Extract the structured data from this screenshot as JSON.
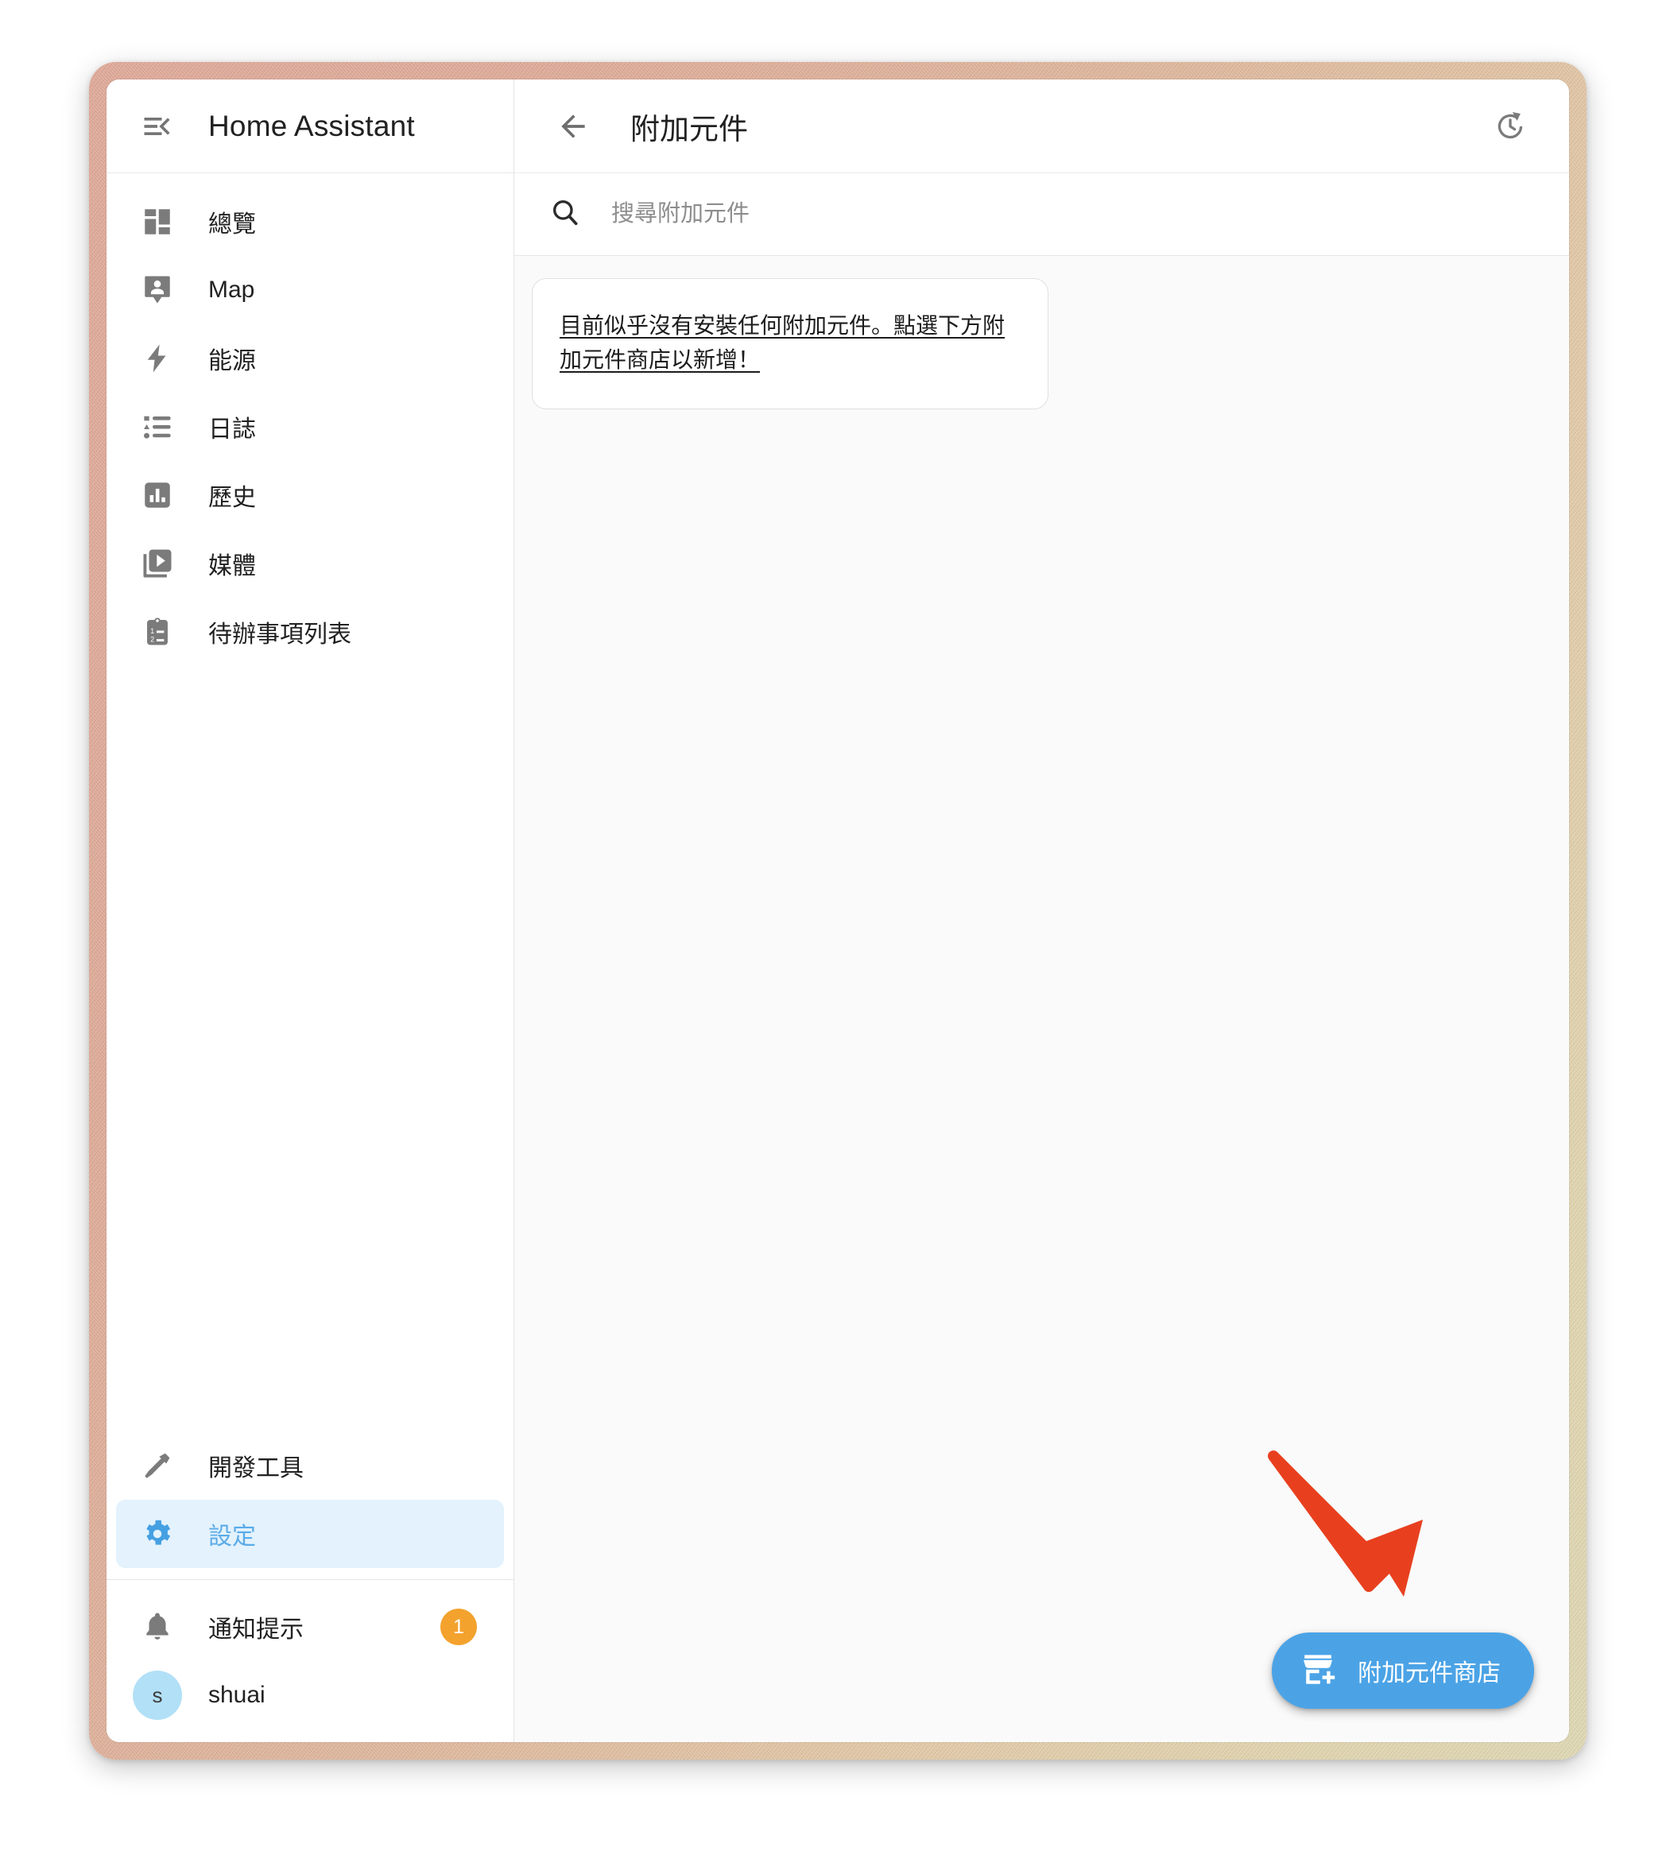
{
  "app": {
    "sidebar_title": "Home Assistant",
    "menu_icon": "menu-collapse-icon"
  },
  "sidebar": {
    "items": [
      {
        "label": "總覽",
        "icon": "view-dashboard-icon",
        "active": false
      },
      {
        "label": "Map",
        "icon": "map-marker-account-icon",
        "active": false
      },
      {
        "label": "能源",
        "icon": "lightning-bolt-icon",
        "active": false
      },
      {
        "label": "日誌",
        "icon": "format-list-bulleted-type-icon",
        "active": false
      },
      {
        "label": "歷史",
        "icon": "chart-box-icon",
        "active": false
      },
      {
        "label": "媒體",
        "icon": "play-box-multiple-icon",
        "active": false
      },
      {
        "label": "待辦事項列表",
        "icon": "clipboard-list-icon",
        "active": false
      }
    ],
    "bottom_items": [
      {
        "label": "開發工具",
        "icon": "hammer-icon",
        "active": false
      },
      {
        "label": "設定",
        "icon": "cog-icon",
        "active": true
      }
    ],
    "notifications": {
      "label": "通知提示",
      "icon": "bell-icon",
      "badge_count": "1",
      "badge_color": "#f3a22d"
    },
    "user": {
      "name": "shuai",
      "avatar_initial": "s",
      "avatar_color": "#b2e0f7"
    },
    "active_color": "#5aabe8",
    "active_background": "#e3f2fd"
  },
  "toolbar": {
    "back_icon": "arrow-left-icon",
    "title": "附加元件",
    "refresh_icon": "update-clock-icon"
  },
  "search": {
    "icon": "search-icon",
    "placeholder": "搜尋附加元件",
    "value": ""
  },
  "content": {
    "empty_message": "目前似乎沒有安裝任何附加元件。點選下方附加元件商店以新增！"
  },
  "fab": {
    "label": "附加元件商店",
    "icon": "store-plus-icon",
    "color": "#4ba3e6"
  },
  "annotation": {
    "arrow_color": "#e8401f",
    "arrow_icon": "pointer-arrow-icon"
  }
}
